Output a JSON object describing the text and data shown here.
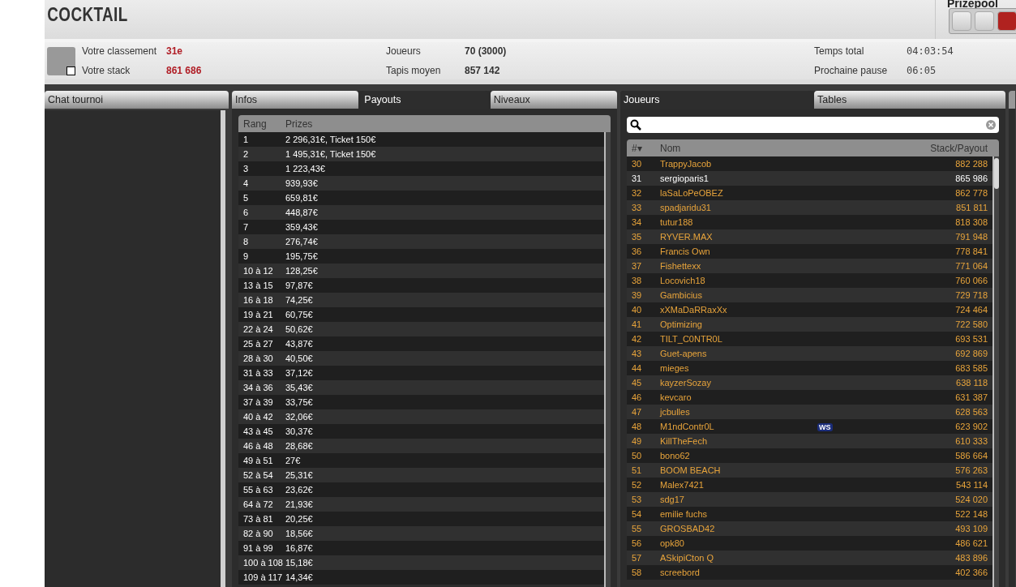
{
  "header": {
    "title": "COCKTAIL",
    "prizepool": {
      "label": "Prizepool"
    }
  },
  "info": {
    "left": [
      {
        "label": "Votre classement",
        "value": "31e"
      },
      {
        "label": "Votre stack",
        "value": "861 686"
      }
    ],
    "middle": [
      {
        "label": "Joueurs",
        "value": "70 (3000)"
      },
      {
        "label": "Tapis moyen",
        "value": "857 142"
      }
    ],
    "right": [
      {
        "label": "Temps total",
        "value": "04:03:54"
      },
      {
        "label": "Prochaine pause",
        "value": "06:05"
      }
    ]
  },
  "chat": {
    "title": "Chat tournoi"
  },
  "payouts_panel": {
    "tabs": [
      {
        "label": "Infos",
        "selected": false
      },
      {
        "label": "Payouts",
        "selected": true
      },
      {
        "label": "Niveaux",
        "selected": false
      }
    ],
    "columns": [
      "Rang",
      "Prizes"
    ],
    "rows": [
      [
        "1",
        "2 296,31€, Ticket 150€"
      ],
      [
        "2",
        "1 495,31€, Ticket 150€"
      ],
      [
        "3",
        "1 223,43€"
      ],
      [
        "4",
        "939,93€"
      ],
      [
        "5",
        "659,81€"
      ],
      [
        "6",
        "448,87€"
      ],
      [
        "7",
        "359,43€"
      ],
      [
        "8",
        "276,74€"
      ],
      [
        "9",
        "195,75€"
      ],
      [
        "10 à 12",
        "128,25€"
      ],
      [
        "13 à 15",
        "97,87€"
      ],
      [
        "16 à 18",
        "74,25€"
      ],
      [
        "19 à 21",
        "60,75€"
      ],
      [
        "22 à 24",
        "50,62€"
      ],
      [
        "25 à 27",
        "43,87€"
      ],
      [
        "28 à 30",
        "40,50€"
      ],
      [
        "31 à 33",
        "37,12€"
      ],
      [
        "34 à 36",
        "35,43€"
      ],
      [
        "37 à 39",
        "33,75€"
      ],
      [
        "40 à 42",
        "32,06€"
      ],
      [
        "43 à 45",
        "30,37€"
      ],
      [
        "46 à 48",
        "28,68€"
      ],
      [
        "49 à 51",
        "27€"
      ],
      [
        "52 à 54",
        "25,31€"
      ],
      [
        "55 à 63",
        "23,62€"
      ],
      [
        "64 à 72",
        "21,93€"
      ],
      [
        "73 à 81",
        "20,25€"
      ],
      [
        "82 à 90",
        "18,56€"
      ],
      [
        "91 à 99",
        "16,87€"
      ],
      [
        "100 à 108",
        "15,18€"
      ],
      [
        "109 à 117",
        "14,34€"
      ]
    ]
  },
  "players_panel": {
    "tabs": [
      {
        "label": "Joueurs",
        "selected": true
      },
      {
        "label": "Tables",
        "selected": false
      }
    ],
    "columns": [
      "#▾",
      "Nom",
      "Stack/Payout"
    ],
    "rows": [
      {
        "rank": "30",
        "name": "TrappyJacob",
        "stack": "882 288",
        "selected": false
      },
      {
        "rank": "31",
        "name": "sergioparis1",
        "stack": "865 986",
        "selected": true
      },
      {
        "rank": "32",
        "name": "laSaLoPeOBEZ",
        "stack": "862 778",
        "selected": false
      },
      {
        "rank": "33",
        "name": "spadjaridu31",
        "stack": "851 811",
        "selected": false
      },
      {
        "rank": "34",
        "name": "tutur188",
        "stack": "818 308",
        "selected": false
      },
      {
        "rank": "35",
        "name": "RYVER.MAX",
        "stack": "791 948",
        "selected": false
      },
      {
        "rank": "36",
        "name": "Francis Own",
        "stack": "778 841",
        "selected": false
      },
      {
        "rank": "37",
        "name": "Fishettexx",
        "stack": "771 064",
        "selected": false
      },
      {
        "rank": "38",
        "name": "Locovich18",
        "stack": "760 066",
        "selected": false
      },
      {
        "rank": "39",
        "name": "Gambicius",
        "stack": "729 718",
        "selected": false
      },
      {
        "rank": "40",
        "name": "xXMaDaRRaxXx",
        "stack": "724 464",
        "selected": false
      },
      {
        "rank": "41",
        "name": "Optimizing",
        "stack": "722 580",
        "selected": false
      },
      {
        "rank": "42",
        "name": "TILT_C0NTR0L",
        "stack": "693 531",
        "selected": false
      },
      {
        "rank": "43",
        "name": "Guet-apens",
        "stack": "692 869",
        "selected": false
      },
      {
        "rank": "44",
        "name": "mieges",
        "stack": "683 585",
        "selected": false
      },
      {
        "rank": "45",
        "name": "kayzerSozay",
        "stack": "638 118",
        "selected": false
      },
      {
        "rank": "46",
        "name": "kevcaro",
        "stack": "631 387",
        "selected": false
      },
      {
        "rank": "47",
        "name": "jcbulles",
        "stack": "628 563",
        "selected": false
      },
      {
        "rank": "48",
        "name": "M1ndContr0L",
        "stack": "623 902",
        "selected": false,
        "badge": "WS"
      },
      {
        "rank": "49",
        "name": "KillTheFech",
        "stack": "610 333",
        "selected": false
      },
      {
        "rank": "50",
        "name": "bono62",
        "stack": "586 664",
        "selected": false
      },
      {
        "rank": "51",
        "name": "BOOM BEACH",
        "stack": "576 263",
        "selected": false
      },
      {
        "rank": "52",
        "name": "Malex7421",
        "stack": "543 114",
        "selected": false
      },
      {
        "rank": "53",
        "name": "sdg17",
        "stack": "524 020",
        "selected": false
      },
      {
        "rank": "54",
        "name": "emilie fuchs",
        "stack": "522 148",
        "selected": false
      },
      {
        "rank": "55",
        "name": "GROSBAD42",
        "stack": "493 109",
        "selected": false
      },
      {
        "rank": "56",
        "name": "opk80",
        "stack": "486 621",
        "selected": false
      },
      {
        "rank": "57",
        "name": "ASkipiCton Q",
        "stack": "483 896",
        "selected": false
      },
      {
        "rank": "58",
        "name": "screebord",
        "stack": "402 366",
        "selected": false
      }
    ]
  }
}
